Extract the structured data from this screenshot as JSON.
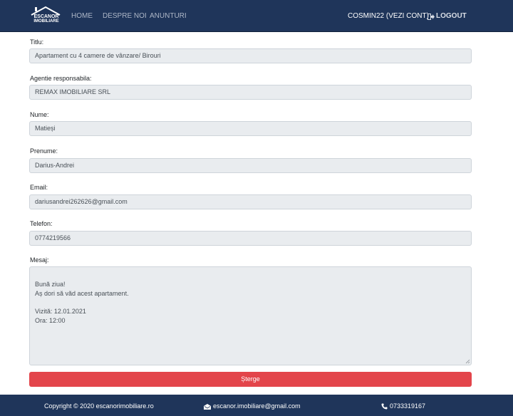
{
  "brand": {
    "logo_line1": "ESCANOR",
    "logo_line2": "IMOBILIARE"
  },
  "nav": {
    "links": [
      "HOME",
      "DESPRE NOI",
      "ANUNTURI"
    ],
    "account": "COSMIN22 (VEZI CONT)",
    "logout": "LOGOUT"
  },
  "form": {
    "fields": [
      {
        "label": "Titlu:",
        "value": "Apartament cu 4 camere de vânzare/ Birouri"
      },
      {
        "label": "Agentie responsabila:",
        "value": "REMAX IMOBILIARE SRL"
      },
      {
        "label": "Nume:",
        "value": "Matieși"
      },
      {
        "label": "Prenume:",
        "value": "Darius-Andrei"
      },
      {
        "label": "Email:",
        "value": "dariusandrei262626@gmail.com"
      },
      {
        "label": "Telefon:",
        "value": "0774219566"
      }
    ],
    "message_label": "Mesaj:",
    "message": "Bună ziua!\nAș dori să văd acest apartament.\n\nVizită: 12.01.2021\nOra: 12:00",
    "delete_label": "Șterge"
  },
  "footer": {
    "copyright": "Copyright © 2020 escanorimobiliare.ro",
    "email": "escanor.imobiliare@gmail.com",
    "phone": "0733319167"
  },
  "colors": {
    "navbar": "#1f355a",
    "field_bg": "#e9ecef",
    "delete_button": "#e3454b"
  }
}
